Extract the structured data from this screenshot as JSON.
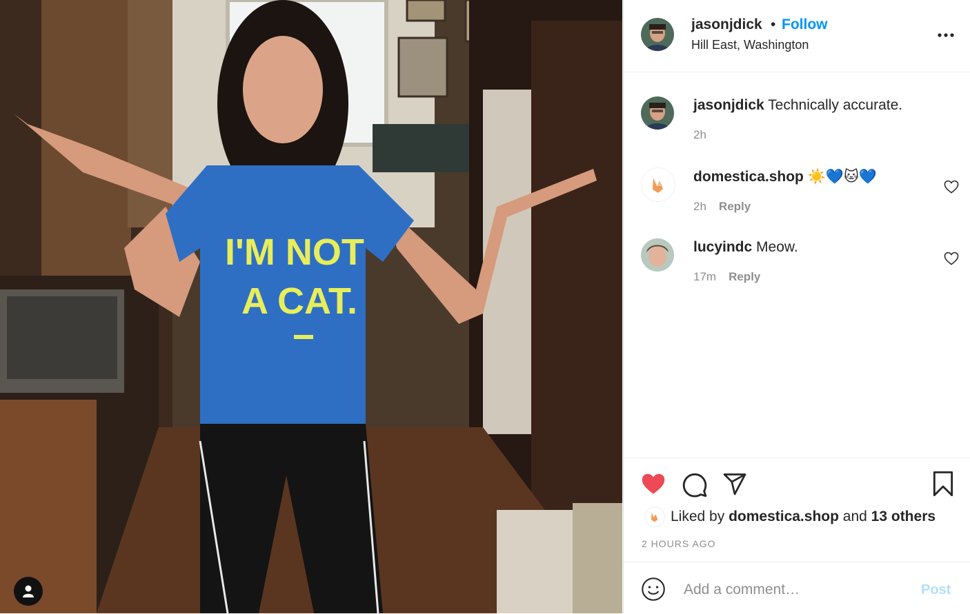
{
  "post": {
    "author": "jasonjdick",
    "follow_label": "Follow",
    "separator": "•",
    "location": "Hill East, Washington",
    "photo_text_line1": "I'M NOT",
    "photo_text_line2": "A CAT.",
    "time_ago": "2 HOURS AGO"
  },
  "comments": [
    {
      "user": "jasonjdick",
      "text": "Technically accurate.",
      "time": "2h",
      "reply": "",
      "has_like": false
    },
    {
      "user": "domestica.shop",
      "text": "☀️💙🐱💙",
      "time": "2h",
      "reply": "Reply",
      "has_like": true
    },
    {
      "user": "lucyindc",
      "text": "Meow.",
      "time": "17m",
      "reply": "Reply",
      "has_like": true
    }
  ],
  "likes": {
    "prefix": "Liked by",
    "user": "domestica.shop",
    "conjunction": "and",
    "others": "13 others",
    "liked": true
  },
  "composer": {
    "placeholder": "Add a comment…",
    "post_label": "Post"
  },
  "colors": {
    "link_blue": "#0095f6",
    "post_disabled": "#b2dffc",
    "like_red": "#ed4956",
    "muted": "#8e8e8e"
  },
  "icons": {
    "more": "more-horizontal-icon",
    "heart": "heart-icon",
    "comment": "comment-bubble-icon",
    "share": "paper-plane-icon",
    "save": "bookmark-icon",
    "emoji": "smiley-icon",
    "tag": "user-tag-icon"
  }
}
